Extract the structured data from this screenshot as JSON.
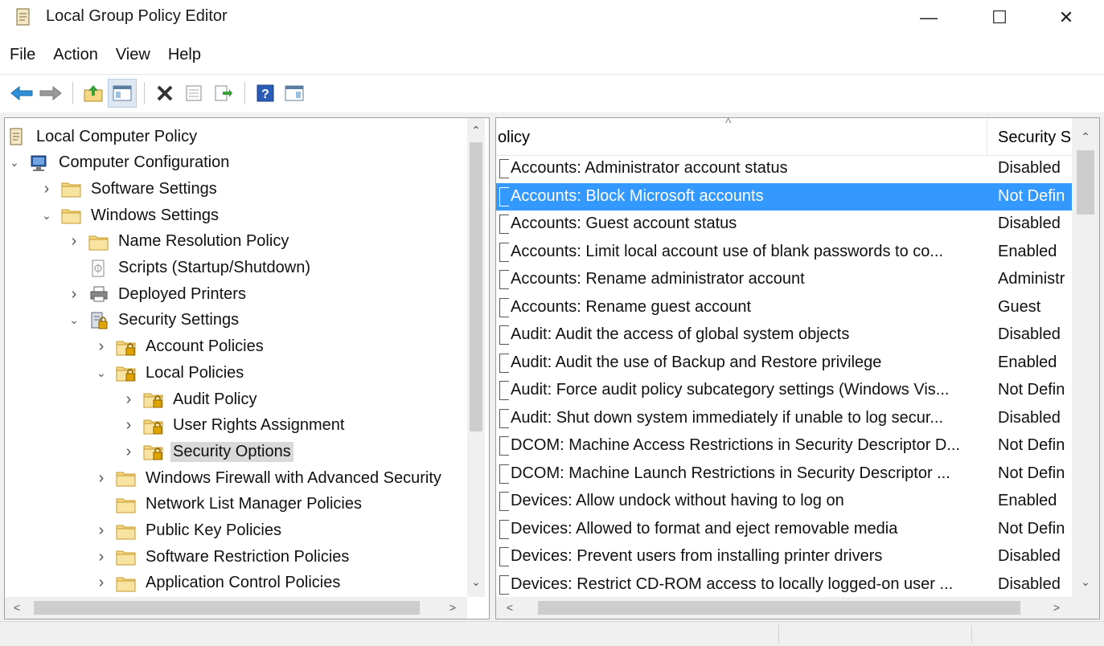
{
  "window": {
    "title": "Local Group Policy Editor",
    "minimize_glyph": "—",
    "maximize_glyph": "☐",
    "close_glyph": "✕"
  },
  "menu": [
    "File",
    "Action",
    "View",
    "Help"
  ],
  "toolbar": [
    {
      "name": "back-icon",
      "glyph": "back"
    },
    {
      "name": "forward-icon",
      "glyph": "forward"
    },
    {
      "name": "up-folder-icon",
      "glyph": "up"
    },
    {
      "name": "show-hide-tree-icon",
      "glyph": "tree",
      "pressed": true
    },
    {
      "name": "delete-icon",
      "glyph": "delete"
    },
    {
      "name": "properties-icon",
      "glyph": "props"
    },
    {
      "name": "export-list-icon",
      "glyph": "export"
    },
    {
      "name": "help-icon",
      "glyph": "help"
    },
    {
      "name": "show-action-pane-icon",
      "glyph": "pane"
    }
  ],
  "tree": [
    {
      "label": "Local Computer Policy",
      "icon": "policy-doc-icon",
      "twisty": "",
      "level": 0
    },
    {
      "label": "Computer Configuration",
      "icon": "computer-icon",
      "twisty": "open",
      "level": 0
    },
    {
      "label": "Software Settings",
      "icon": "folder-icon",
      "twisty": "closed",
      "level": 1
    },
    {
      "label": "Windows Settings",
      "icon": "folder-icon",
      "twisty": "open",
      "level": 1
    },
    {
      "label": "Name Resolution Policy",
      "icon": "folder-icon",
      "twisty": "closed",
      "level": 2
    },
    {
      "label": "Scripts (Startup/Shutdown)",
      "icon": "script-icon",
      "twisty": "",
      "level": 2
    },
    {
      "label": "Deployed Printers",
      "icon": "printer-icon",
      "twisty": "closed",
      "level": 2
    },
    {
      "label": "Security Settings",
      "icon": "security-settings-icon",
      "twisty": "open",
      "level": 2
    },
    {
      "label": "Account Policies",
      "icon": "locked-folder-icon",
      "twisty": "closed",
      "level": 3
    },
    {
      "label": "Local Policies",
      "icon": "locked-folder-icon",
      "twisty": "open",
      "level": 3
    },
    {
      "label": "Audit Policy",
      "icon": "locked-folder-icon",
      "twisty": "closed",
      "level": 4
    },
    {
      "label": "User Rights Assignment",
      "icon": "locked-folder-icon",
      "twisty": "closed",
      "level": 4
    },
    {
      "label": "Security Options",
      "icon": "locked-folder-icon",
      "twisty": "closed",
      "level": 4,
      "selected": true
    },
    {
      "label": "Windows Firewall with Advanced Security",
      "icon": "folder-icon",
      "twisty": "closed",
      "level": 3
    },
    {
      "label": "Network List Manager Policies",
      "icon": "folder-icon",
      "twisty": "",
      "level": 3
    },
    {
      "label": "Public Key Policies",
      "icon": "folder-icon",
      "twisty": "closed",
      "level": 3
    },
    {
      "label": "Software Restriction Policies",
      "icon": "folder-icon",
      "twisty": "closed",
      "level": 3
    },
    {
      "label": "Application Control Policies",
      "icon": "folder-icon",
      "twisty": "closed",
      "level": 3
    }
  ],
  "list": {
    "columns": {
      "policy": "olicy",
      "setting": "Security S"
    },
    "rows": [
      {
        "policy": "Accounts: Administrator account status",
        "setting": "Disabled"
      },
      {
        "policy": "Accounts: Block Microsoft accounts",
        "setting": "Not Defin",
        "selected": true
      },
      {
        "policy": "Accounts: Guest account status",
        "setting": "Disabled"
      },
      {
        "policy": "Accounts: Limit local account use of blank passwords to co...",
        "setting": "Enabled"
      },
      {
        "policy": "Accounts: Rename administrator account",
        "setting": "Administr"
      },
      {
        "policy": "Accounts: Rename guest account",
        "setting": "Guest"
      },
      {
        "policy": "Audit: Audit the access of global system objects",
        "setting": "Disabled"
      },
      {
        "policy": "Audit: Audit the use of Backup and Restore privilege",
        "setting": "Enabled"
      },
      {
        "policy": "Audit: Force audit policy subcategory settings (Windows Vis...",
        "setting": "Not Defin"
      },
      {
        "policy": "Audit: Shut down system immediately if unable to log secur...",
        "setting": "Disabled"
      },
      {
        "policy": "DCOM: Machine Access Restrictions in Security Descriptor D...",
        "setting": "Not Defin"
      },
      {
        "policy": "DCOM: Machine Launch Restrictions in Security Descriptor ...",
        "setting": "Not Defin"
      },
      {
        "policy": "Devices: Allow undock without having to log on",
        "setting": "Enabled"
      },
      {
        "policy": "Devices: Allowed to format and eject removable media",
        "setting": "Not Defin"
      },
      {
        "policy": "Devices: Prevent users from installing printer drivers",
        "setting": "Disabled"
      },
      {
        "policy": "Devices: Restrict CD-ROM access to locally logged-on user ...",
        "setting": "Disabled"
      }
    ]
  },
  "colors": {
    "selection": "#3399ff",
    "tree_selection": "#d9d9d9",
    "folder": "#f5d682"
  }
}
